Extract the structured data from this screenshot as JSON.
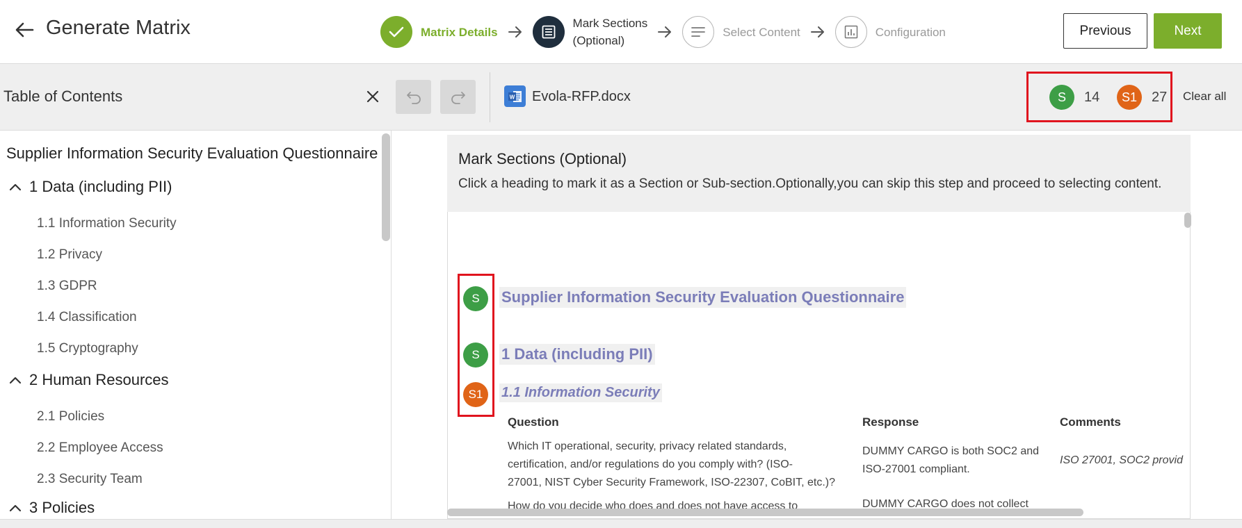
{
  "header": {
    "title": "Generate Matrix",
    "steps": [
      {
        "label_line1": "Matrix Details",
        "label_line2": "",
        "state": "done",
        "icon": "check-icon"
      },
      {
        "label_line1": "Mark Sections",
        "label_line2": "(Optional)",
        "state": "current",
        "icon": "document-list-icon"
      },
      {
        "label_line1": "Select Content",
        "label_line2": "",
        "state": "todo",
        "icon": "lines-icon"
      },
      {
        "label_line1": "Configuration",
        "label_line2": "",
        "state": "todo",
        "icon": "chart-icon"
      }
    ],
    "previous_label": "Previous",
    "next_label": "Next"
  },
  "toc": {
    "title": "Table of Contents",
    "root": "Supplier Information Security Evaluation Questionnaire",
    "sections": [
      {
        "label": "1 Data (including PII)",
        "items": [
          "1.1 Information Security",
          "1.2 Privacy",
          "1.3 GDPR",
          "1.4 Classification",
          "1.5 Cryptography"
        ]
      },
      {
        "label": "2 Human Resources",
        "items": [
          "2.1 Policies",
          "2.2 Employee Access",
          "2.3 Security Team"
        ]
      },
      {
        "label": "3 Policies",
        "items": []
      }
    ]
  },
  "toolbar": {
    "file_name": "Evola-RFP.docx",
    "section_badge": "S",
    "section_count": "14",
    "subsection_badge": "S1",
    "subsection_count": "27",
    "clear_all_label": "Clear all"
  },
  "instructions": {
    "title": "Mark Sections (Optional)",
    "text": "Click a heading to mark it as a Section or Sub-section.Optionally,you can skip this step and proceed to selecting content."
  },
  "document": {
    "marks": [
      "S",
      "S",
      "S1"
    ],
    "heading_main": "Supplier Information Security Evaluation Questionnaire",
    "heading_1": "1  Data (including PII)",
    "heading_1_1": "1.1  Information Security",
    "table": {
      "headers": [
        "Question",
        "Response",
        "Comments"
      ],
      "row1": {
        "question": [
          "Which IT operational, security, privacy related standards,",
          "certification, and/or regulations do you comply with? (ISO-",
          "27001, NIST Cyber Security Framework, ISO-22307, CoBIT, etc.)?"
        ],
        "response": [
          "DUMMY CARGO is both SOC2 and",
          "ISO-27001 compliant."
        ],
        "comment": "ISO 27001, SOC2 provid"
      },
      "row2": {
        "question": "How do you decide who does and does not have access to",
        "response": "DUMMY CARGO does not collect"
      }
    }
  },
  "colors": {
    "accent_green": "#7cae2c",
    "section_badge": "#3d9e46",
    "subsection_badge": "#e06417",
    "highlight_red": "#e0141e",
    "heading_purple": "#7b7db8",
    "current_step": "#1f2e3d"
  }
}
